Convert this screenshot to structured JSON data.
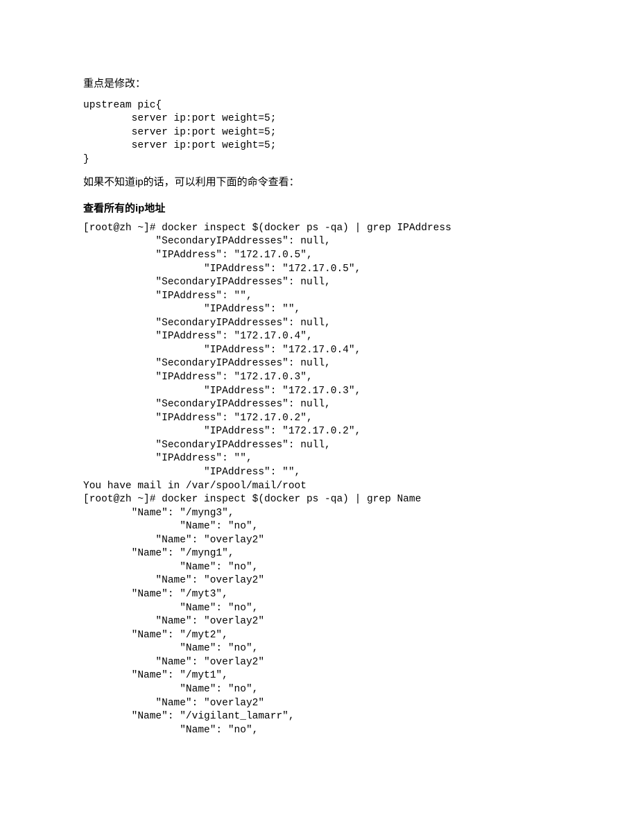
{
  "para1": "重点是修改：",
  "code1": "upstream pic{\n        server ip:port weight=5;\n        server ip:port weight=5;\n        server ip:port weight=5;\n}",
  "para2": "如果不知道ip的话，可以利用下面的命令查看：",
  "heading1": "查看所有的ip地址",
  "code2": "[root@zh ~]# docker inspect $(docker ps -qa) | grep IPAddress\n            \"SecondaryIPAddresses\": null,\n            \"IPAddress\": \"172.17.0.5\",\n                    \"IPAddress\": \"172.17.0.5\",\n            \"SecondaryIPAddresses\": null,\n            \"IPAddress\": \"\",\n                    \"IPAddress\": \"\",\n            \"SecondaryIPAddresses\": null,\n            \"IPAddress\": \"172.17.0.4\",\n                    \"IPAddress\": \"172.17.0.4\",\n            \"SecondaryIPAddresses\": null,\n            \"IPAddress\": \"172.17.0.3\",\n                    \"IPAddress\": \"172.17.0.3\",\n            \"SecondaryIPAddresses\": null,\n            \"IPAddress\": \"172.17.0.2\",\n                    \"IPAddress\": \"172.17.0.2\",\n            \"SecondaryIPAddresses\": null,\n            \"IPAddress\": \"\",\n                    \"IPAddress\": \"\",\nYou have mail in /var/spool/mail/root\n[root@zh ~]# docker inspect $(docker ps -qa) | grep Name\n        \"Name\": \"/myng3\",\n                \"Name\": \"no\",\n            \"Name\": \"overlay2\"\n        \"Name\": \"/myng1\",\n                \"Name\": \"no\",\n            \"Name\": \"overlay2\"\n        \"Name\": \"/myt3\",\n                \"Name\": \"no\",\n            \"Name\": \"overlay2\"\n        \"Name\": \"/myt2\",\n                \"Name\": \"no\",\n            \"Name\": \"overlay2\"\n        \"Name\": \"/myt1\",\n                \"Name\": \"no\",\n            \"Name\": \"overlay2\"\n        \"Name\": \"/vigilant_lamarr\",\n                \"Name\": \"no\","
}
